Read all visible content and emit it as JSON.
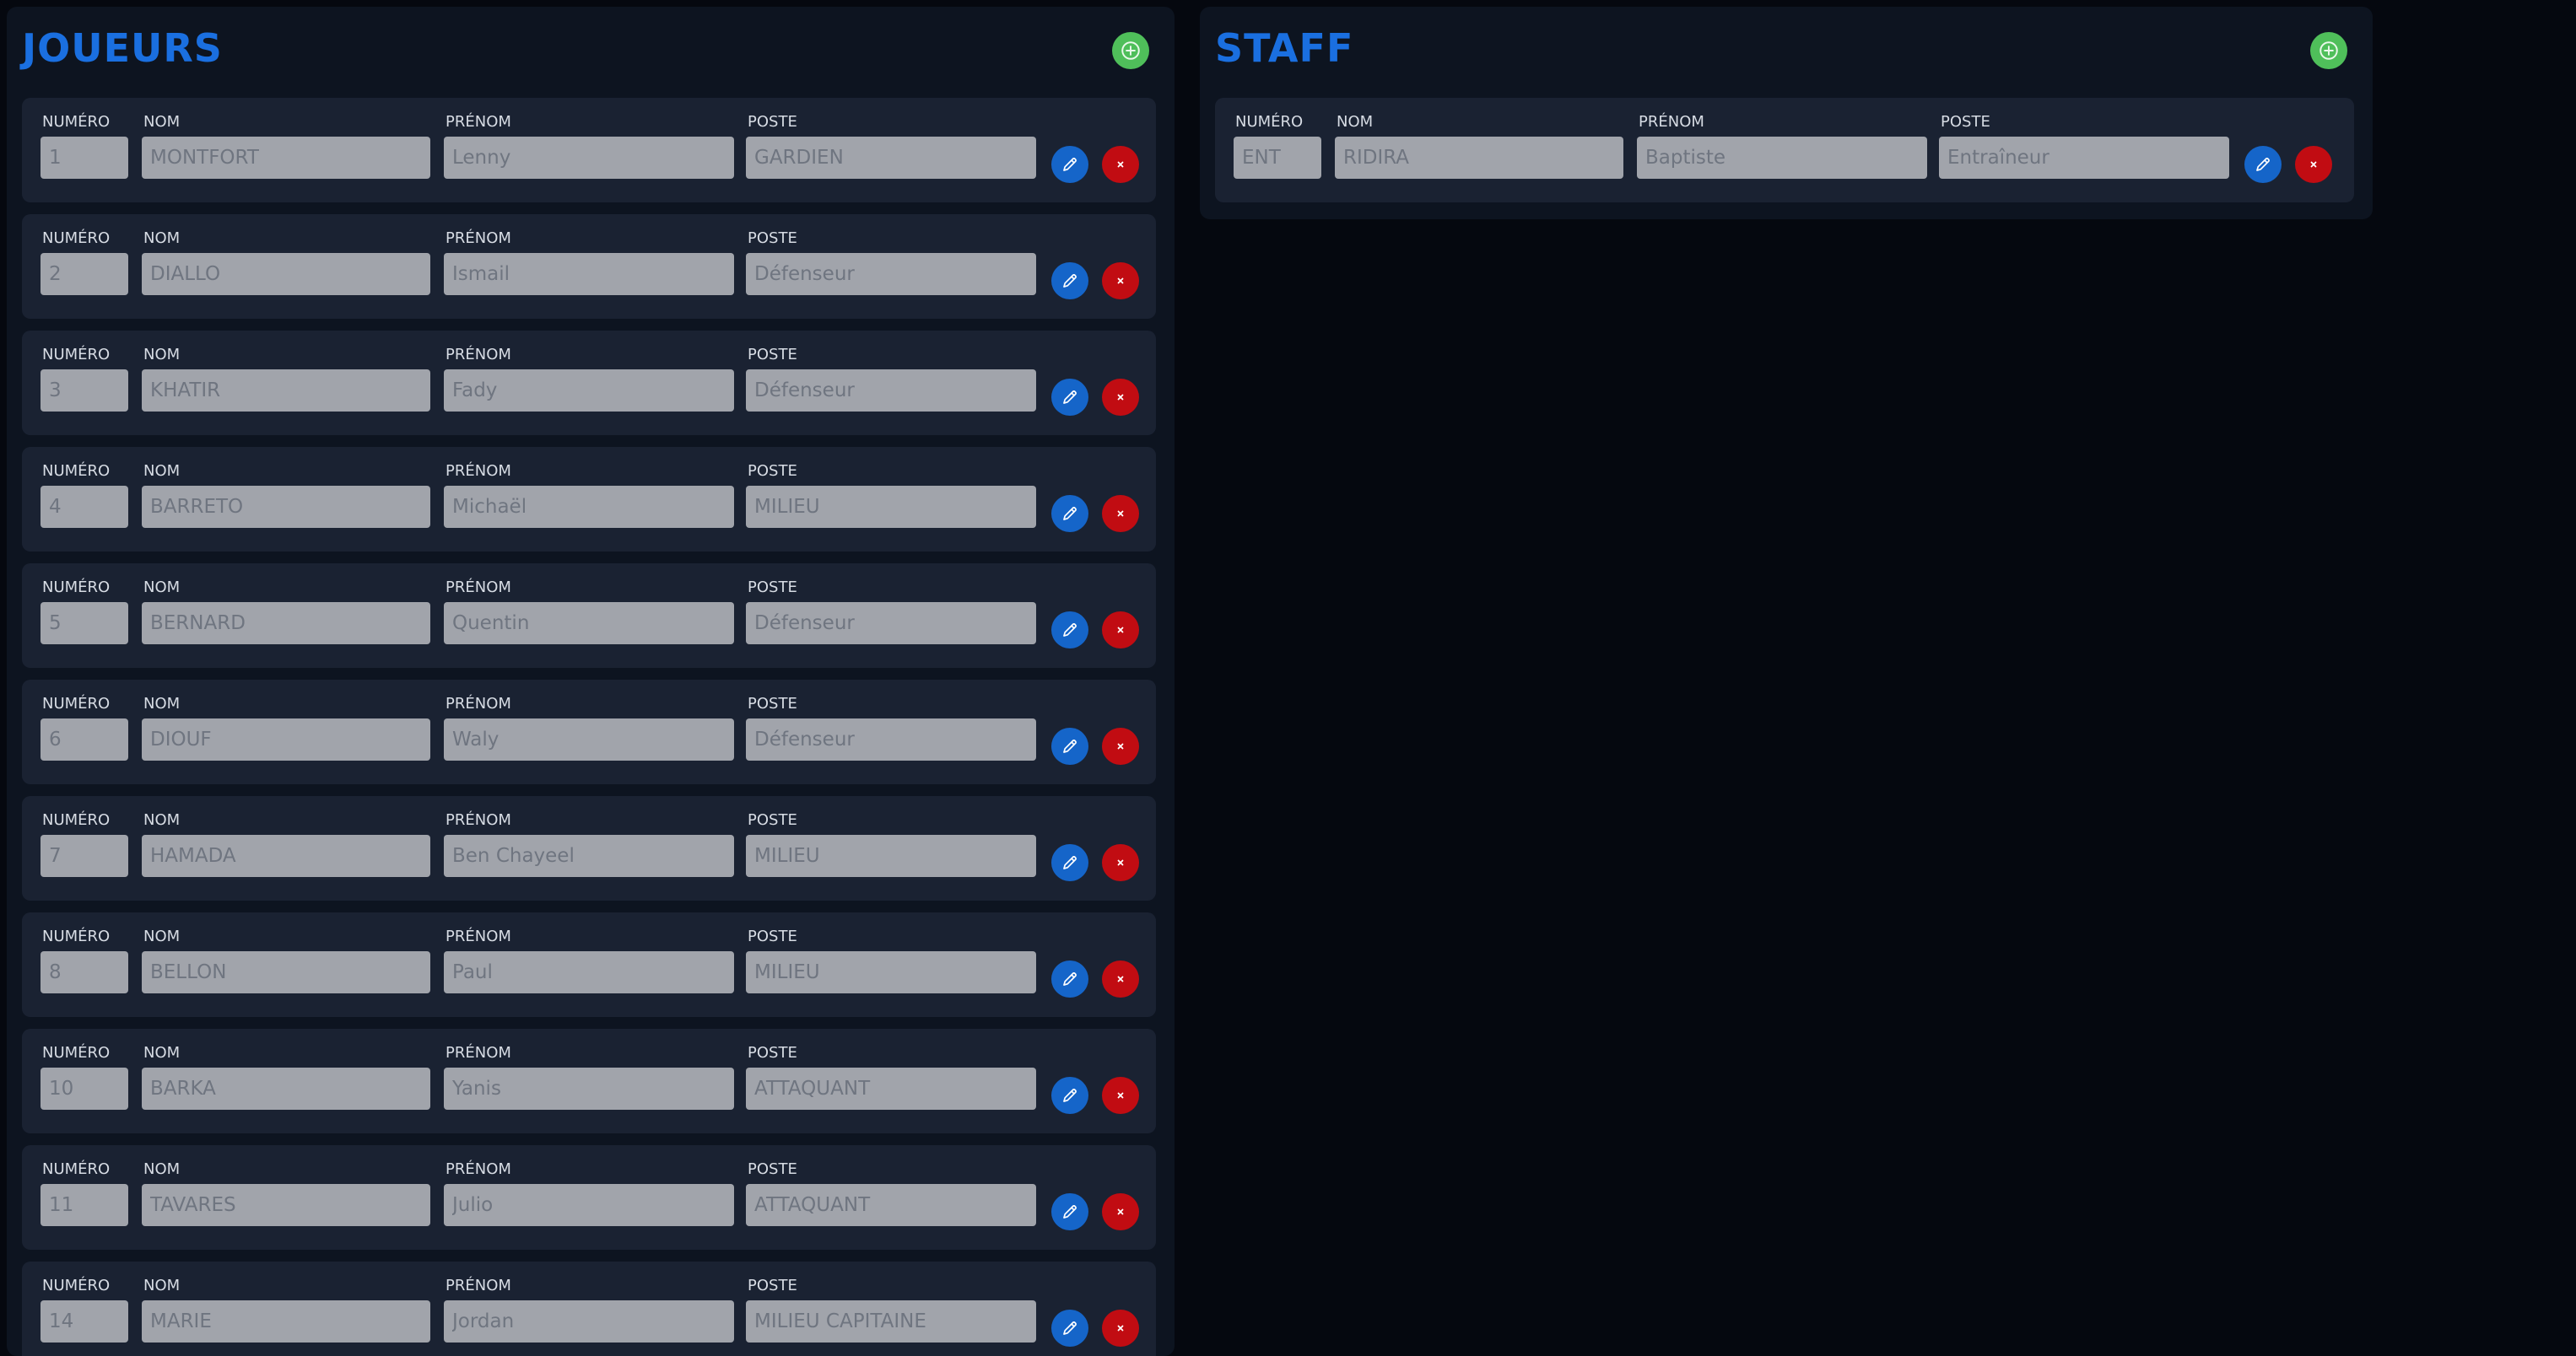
{
  "labels": {
    "numero": "NUMÉRO",
    "nom": "NOM",
    "prenom": "PRÉNOM",
    "poste": "POSTE"
  },
  "icons": {
    "add": "add-circle-icon",
    "edit": "pencil-icon",
    "delete": "close-icon"
  },
  "colors": {
    "title": "#1a6fe0",
    "add": "#4fbf5a",
    "edit": "#1565c9",
    "delete": "#c10c12"
  },
  "players": {
    "title": "JOUEURS",
    "rows": [
      {
        "numero": "1",
        "nom": "MONTFORT",
        "prenom": "Lenny",
        "poste": "GARDIEN"
      },
      {
        "numero": "2",
        "nom": "DIALLO",
        "prenom": "Ismail",
        "poste": "Défenseur"
      },
      {
        "numero": "3",
        "nom": "KHATIR",
        "prenom": "Fady",
        "poste": "Défenseur"
      },
      {
        "numero": "4",
        "nom": "BARRETO",
        "prenom": "Michaël",
        "poste": "MILIEU"
      },
      {
        "numero": "5",
        "nom": "BERNARD",
        "prenom": "Quentin",
        "poste": "Défenseur"
      },
      {
        "numero": "6",
        "nom": "DIOUF",
        "prenom": "Waly",
        "poste": "Défenseur"
      },
      {
        "numero": "7",
        "nom": "HAMADA",
        "prenom": "Ben Chayeel",
        "poste": "MILIEU"
      },
      {
        "numero": "8",
        "nom": "BELLON",
        "prenom": "Paul",
        "poste": "MILIEU"
      },
      {
        "numero": "10",
        "nom": "BARKA",
        "prenom": "Yanis",
        "poste": "ATTAQUANT"
      },
      {
        "numero": "11",
        "nom": "TAVARES",
        "prenom": "Julio",
        "poste": "ATTAQUANT"
      },
      {
        "numero": "14",
        "nom": "MARIE",
        "prenom": "Jordan",
        "poste": "MILIEU CAPITAINE"
      }
    ]
  },
  "staff": {
    "title": "STAFF",
    "rows": [
      {
        "numero": "ENT",
        "nom": "RIDIRA",
        "prenom": "Baptiste",
        "poste": "Entraîneur"
      }
    ]
  }
}
